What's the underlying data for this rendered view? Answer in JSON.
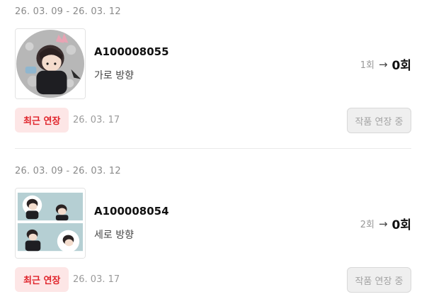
{
  "items": [
    {
      "period": "26. 03. 09 - 26. 03. 12",
      "code": "A100008055",
      "orientation": "가로 방향",
      "count_from": "1회",
      "count_to": "0회",
      "badge": "최근 연장",
      "date": "26. 03. 17",
      "button": "작품 연장 중"
    },
    {
      "period": "26. 03. 09 - 26. 03. 12",
      "code": "A100008054",
      "orientation": "세로 방향",
      "count_from": "2회",
      "count_to": "0회",
      "badge": "최근 연장",
      "date": "26. 03. 17",
      "button": "작품 연장 중"
    }
  ],
  "colors": {
    "badge_bg": "#fde6e6",
    "badge_text": "#e0232a",
    "button_bg": "#efefef",
    "muted_text": "#9a9a9a"
  },
  "icons": {
    "arrow": "arrow-right-icon"
  }
}
